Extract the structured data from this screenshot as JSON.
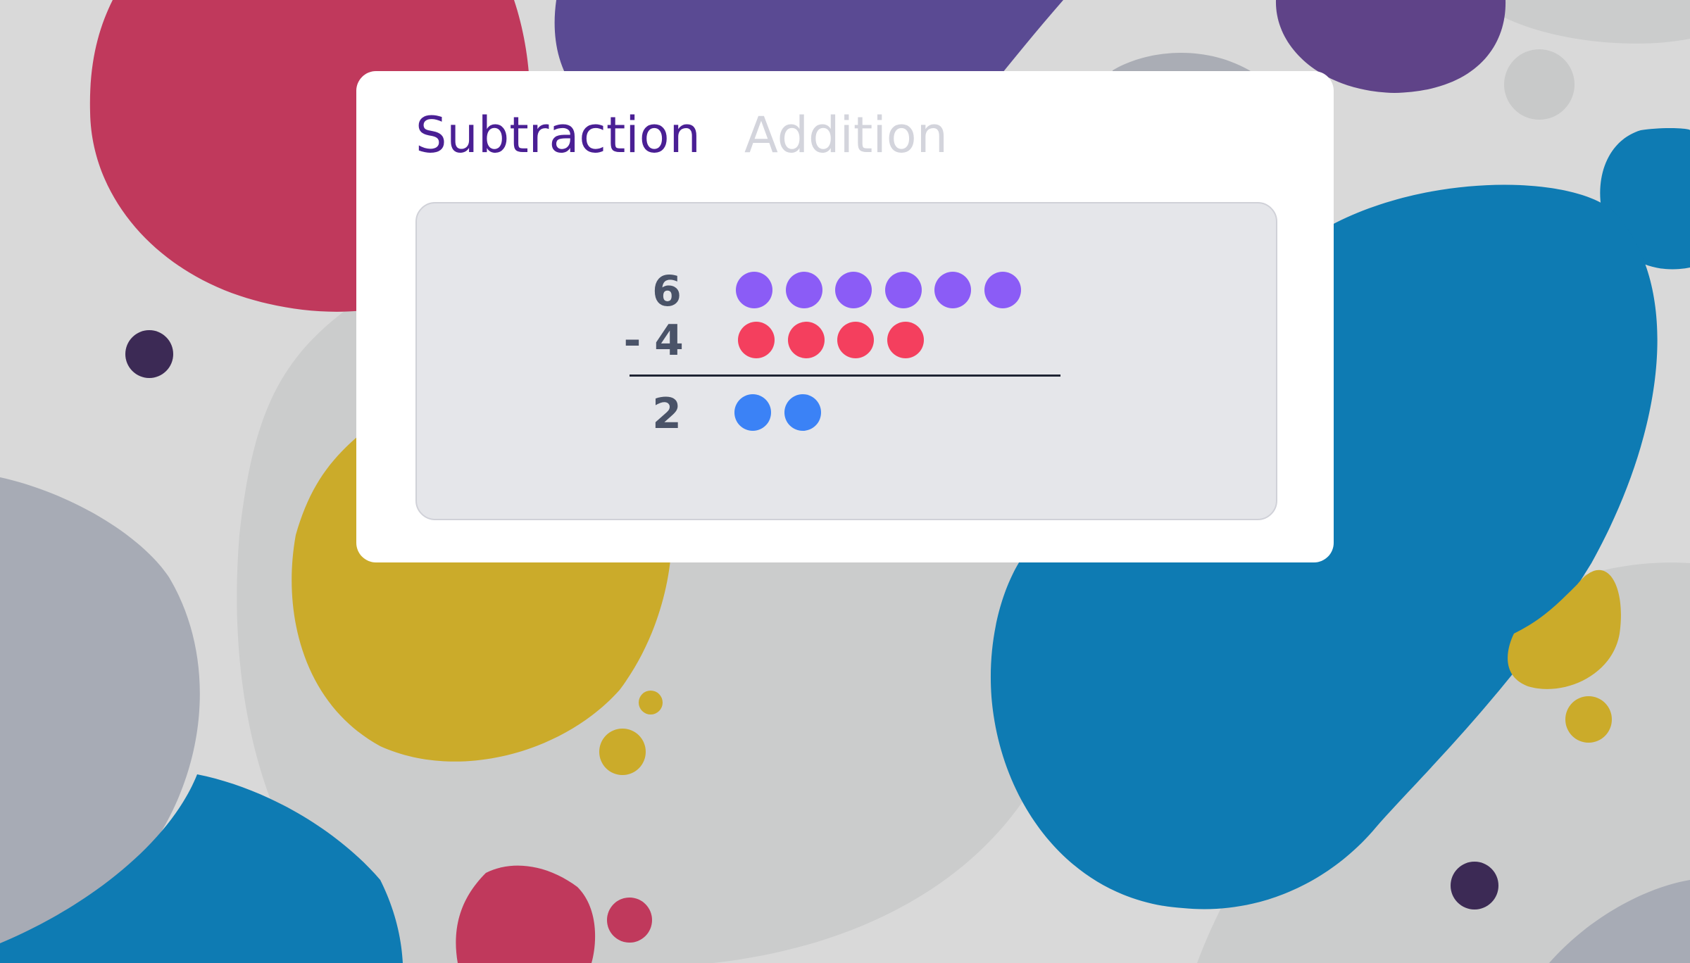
{
  "tabs": [
    {
      "label": "Subtraction",
      "active": true
    },
    {
      "label": "Addition",
      "active": false
    }
  ],
  "equation": {
    "minuend": "6",
    "operator": "-",
    "subtrahend": "4",
    "result": "2"
  },
  "dot_counts": {
    "minuend": 6,
    "subtrahend": 4,
    "result": 2
  },
  "colors": {
    "active_tab": "#4a1f94",
    "inactive_tab": "#d3d4dc",
    "minuend_dots": "#8b5cf6",
    "subtrahend_dots": "#f43f5e",
    "result_dots": "#3b82f6",
    "digits": "#4a5368"
  }
}
